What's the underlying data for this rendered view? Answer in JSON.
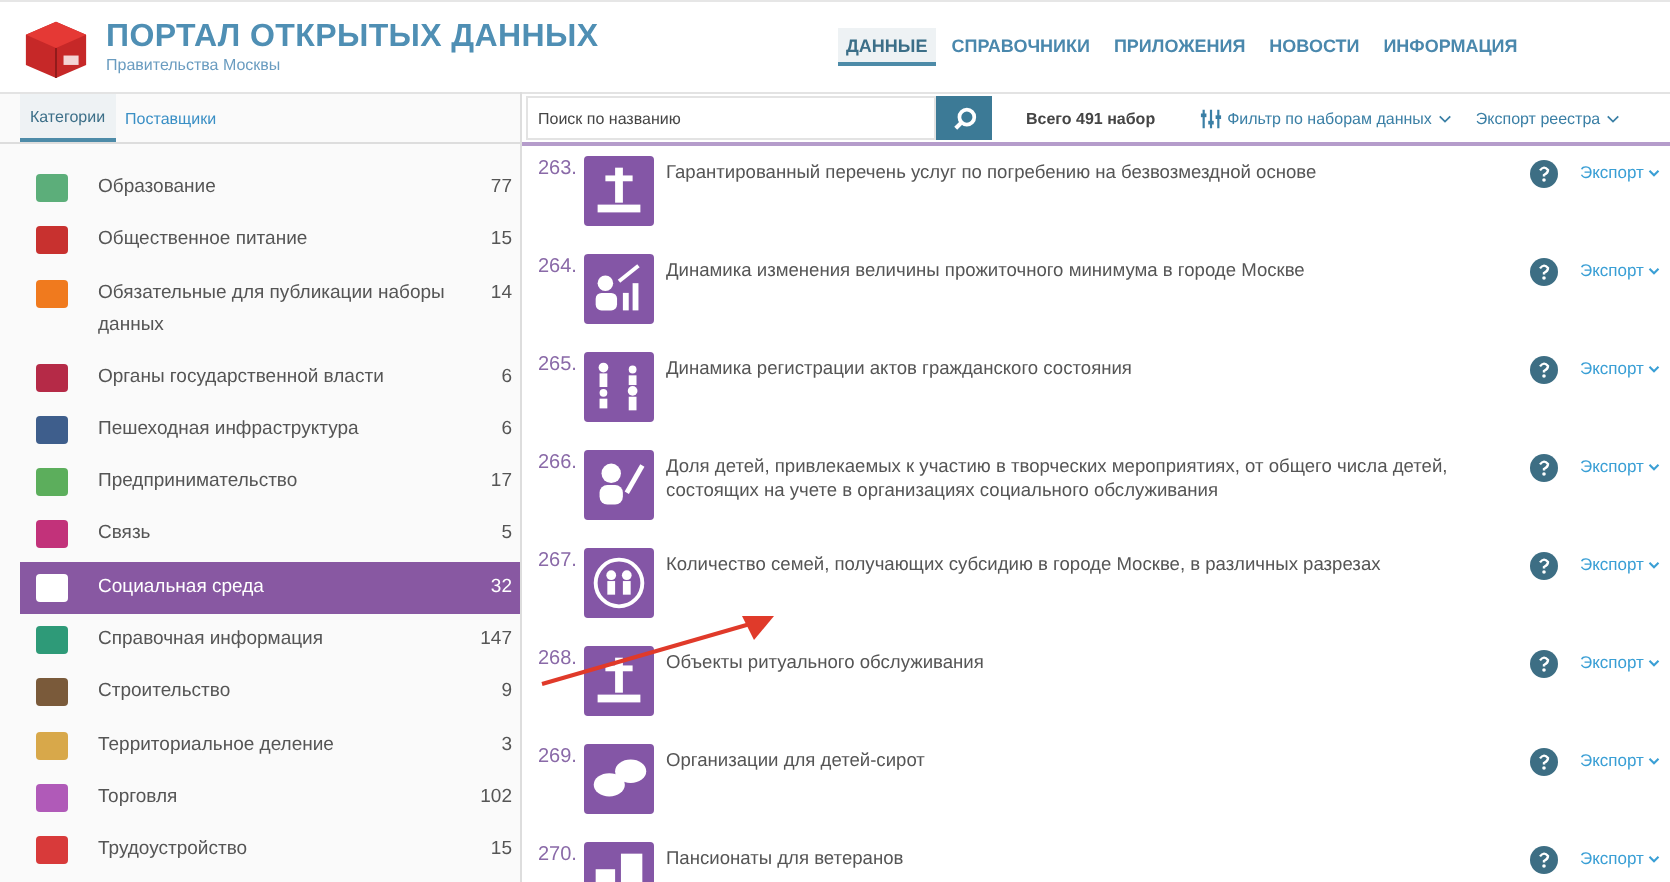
{
  "header": {
    "title": "ПОРТАЛ ОТКРЫТЫХ ДАННЫХ",
    "subtitle": "Правительства Москвы"
  },
  "nav": [
    {
      "label": "ДАННЫЕ",
      "selected": true
    },
    {
      "label": "СПРАВОЧНИКИ",
      "selected": false
    },
    {
      "label": "ПРИЛОЖЕНИЯ",
      "selected": false
    },
    {
      "label": "НОВОСТИ",
      "selected": false
    },
    {
      "label": "ИНФОРМАЦИЯ",
      "selected": false
    }
  ],
  "sidebar": {
    "tabs": [
      {
        "label": "Категории",
        "selected": true
      },
      {
        "label": "Поставщики",
        "selected": false
      }
    ],
    "items": [
      {
        "label": "Образование",
        "count": "77",
        "color": "#5cae7a",
        "selected": false
      },
      {
        "label": "Общественное питание",
        "count": "15",
        "color": "#c8312f",
        "selected": false
      },
      {
        "label": "Обязательные для публикации наборы данных",
        "count": "14",
        "color": "#f07a1e",
        "selected": false
      },
      {
        "label": "Органы государственной власти",
        "count": "6",
        "color": "#b52a47",
        "selected": false
      },
      {
        "label": "Пешеходная инфраструктура",
        "count": "6",
        "color": "#3e5e8c",
        "selected": false
      },
      {
        "label": "Предпринимательство",
        "count": "17",
        "color": "#5cae5c",
        "selected": false
      },
      {
        "label": "Связь",
        "count": "5",
        "color": "#c2327a",
        "selected": false
      },
      {
        "label": "Социальная среда",
        "count": "32",
        "color": "#ffffff",
        "selected": true
      },
      {
        "label": "Справочная информация",
        "count": "147",
        "color": "#2e9a78",
        "selected": false
      },
      {
        "label": "Строительство",
        "count": "9",
        "color": "#7a5a3a",
        "selected": false
      },
      {
        "label": "Территориальное деление",
        "count": "3",
        "color": "#d8a84a",
        "selected": false
      },
      {
        "label": "Торговля",
        "count": "102",
        "color": "#b05ab8",
        "selected": false
      },
      {
        "label": "Трудоустройство",
        "count": "15",
        "color": "#d83a3a",
        "selected": false
      }
    ]
  },
  "toolbar": {
    "search": {
      "placeholder": "Поиск по названию"
    },
    "total": "Всего 491 набор",
    "filter": "Фильтр по наборам данных",
    "export_registry": "Экспорт реестра"
  },
  "datasets": [
    {
      "number": "263.",
      "title": "Гарантированный перечень услуг по погребению на безвозмездной основе",
      "kind": "cross",
      "export": "Экспорт"
    },
    {
      "number": "264.",
      "title": "Динамика изменения величины прожиточного минимума в городе Москве",
      "kind": "growth",
      "export": "Экспорт"
    },
    {
      "number": "265.",
      "title": "Динамика регистрации актов гражданского состояния",
      "kind": "people",
      "export": "Экспорт"
    },
    {
      "number": "266.",
      "title": "Доля детей, привлекаемых к участию в творческих мероприятиях, от общего числа детей, состоящих на учете в организациях социального обслуживания",
      "kind": "child",
      "export": "Экспорт"
    },
    {
      "number": "267.",
      "title": "Количество семей, получающих субсидию в городе Москве, в различных разрезах",
      "kind": "family",
      "export": "Экспорт"
    },
    {
      "number": "268.",
      "title": "Объекты ритуального обслуживания",
      "kind": "cross",
      "export": "Экспорт"
    },
    {
      "number": "269.",
      "title": "Организации для детей-сирот",
      "kind": "speech",
      "export": "Экспорт"
    },
    {
      "number": "270.",
      "title": "Пансионаты для ветеранов",
      "kind": "building",
      "export": "Экспорт"
    }
  ]
}
